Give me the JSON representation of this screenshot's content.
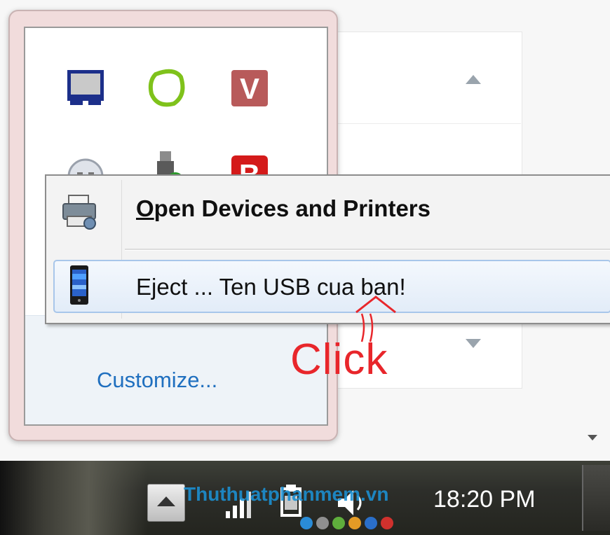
{
  "flyout": {
    "customize_label": "Customize..."
  },
  "tray_icons": [
    {
      "icon": "monitor-icon"
    },
    {
      "icon": "green-ring-icon"
    },
    {
      "icon": "v-app-icon",
      "letter": "V"
    },
    {
      "icon": "smiley-icon"
    },
    {
      "icon": "usb-drive-icon"
    },
    {
      "icon": "b-app-icon",
      "letter": "B"
    }
  ],
  "context_menu": {
    "item1": {
      "label_hotkey": "O",
      "label_rest": "pen Devices and Printers",
      "icon": "printer-icon"
    },
    "item2": {
      "label": "Eject ... Ten USB cua ban!",
      "icon": "phone-device-icon"
    }
  },
  "annotation": {
    "text": "Click"
  },
  "taskbar": {
    "clock": "18:20 PM",
    "watermark": "Thuthuatphanmem.vn",
    "dot_colors": [
      "#2a8cd6",
      "#8f8f8f",
      "#5fae3c",
      "#e39a25",
      "#2a6fc9",
      "#d0312d"
    ]
  },
  "colors": {
    "link": "#1f6fbf",
    "annotation": "#e8262b",
    "menu_highlight_border": "#a8c6ea"
  }
}
